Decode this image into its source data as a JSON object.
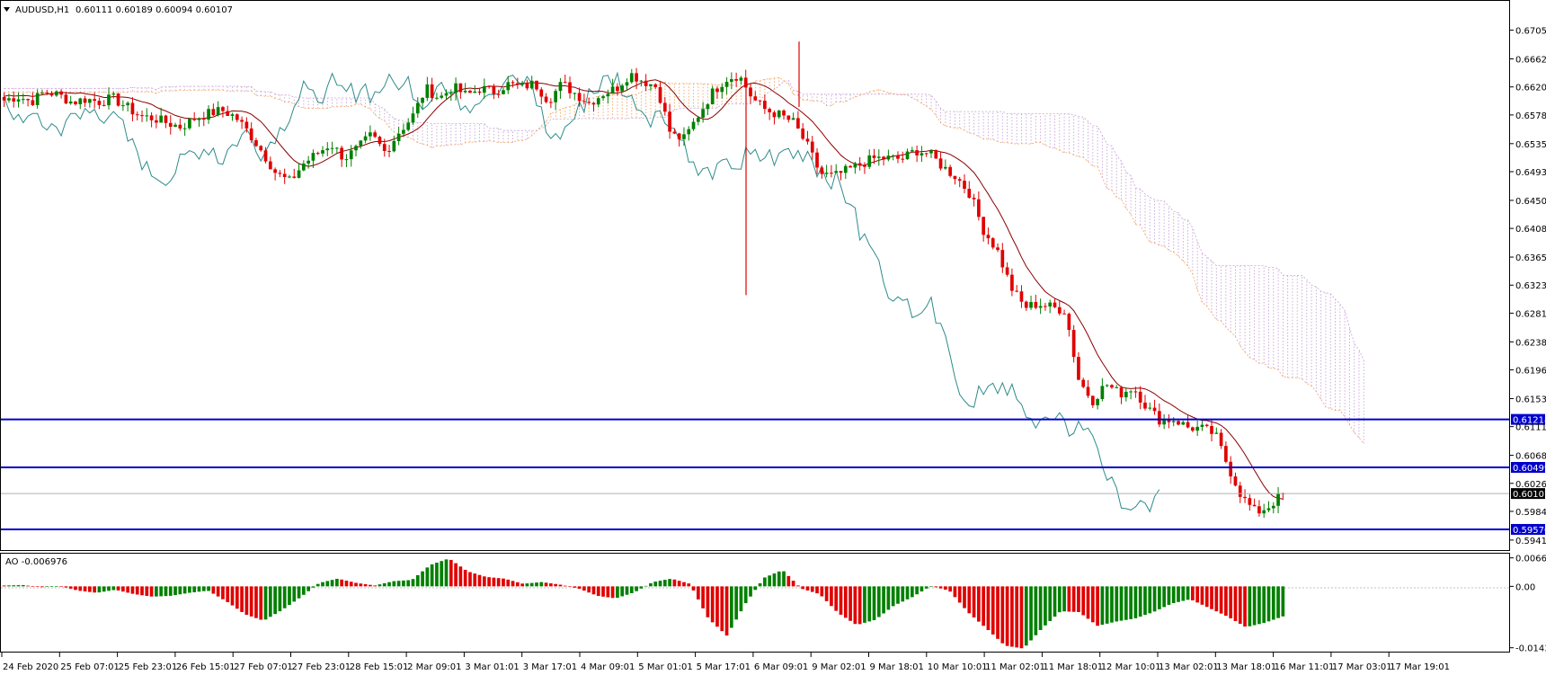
{
  "header": {
    "symbol": "AUDUSD,H1",
    "ohlc": "0.60111 0.60189 0.60094 0.60107",
    "menu_icon": "triangle-down-icon"
  },
  "indicator": {
    "label": "AO -0.006976"
  },
  "colors": {
    "bull": "#008000",
    "bear": "#e00000",
    "ma": "#8b0000",
    "chikou": "#2e8b8b",
    "kumo_orange": "#f4a460",
    "kumo_violet": "#c8a2d8",
    "hline": "#0000cc",
    "price_box": "#000000"
  },
  "chart_data": [
    {
      "type": "candlestick",
      "symbol": "AUDUSD",
      "timeframe": "H1",
      "ylim": [
        0.5926,
        0.6726
      ],
      "y_ticks": [
        "0.67050",
        "0.66620",
        "0.66200",
        "0.65780",
        "0.65350",
        "0.64930",
        "0.64500",
        "0.64080",
        "0.63650",
        "0.63230",
        "0.62810",
        "0.62380",
        "0.61960",
        "0.61530",
        "0.61110",
        "0.60680",
        "0.60260",
        "0.59840",
        "0.59410"
      ],
      "x_ticks": [
        "24 Feb 2020",
        "25 Feb 07:01",
        "25 Feb 23:01",
        "26 Feb 15:01",
        "27 Feb 07:01",
        "27 Feb 23:01",
        "28 Feb 15:01",
        "2 Mar 09:01",
        "3 Mar 01:01",
        "3 Mar 17:01",
        "4 Mar 09:01",
        "5 Mar 01:01",
        "5 Mar 17:01",
        "6 Mar 09:01",
        "9 Mar 02:01",
        "9 Mar 18:01",
        "10 Mar 10:01",
        "11 Mar 02:01",
        "11 Mar 18:01",
        "12 Mar 10:01",
        "13 Mar 02:01",
        "13 Mar 18:01",
        "16 Mar 11:01",
        "17 Mar 03:01",
        "17 Mar 19:01"
      ],
      "close_path": [
        0.66,
        0.6606,
        0.6598,
        0.6613,
        0.6608,
        0.6597,
        0.6602,
        0.6598,
        0.6603,
        0.659,
        0.6576,
        0.6573,
        0.6566,
        0.656,
        0.6573,
        0.658,
        0.6585,
        0.6575,
        0.6551,
        0.6522,
        0.649,
        0.6478,
        0.6505,
        0.652,
        0.6535,
        0.6513,
        0.6528,
        0.6548,
        0.6522,
        0.6552,
        0.6575,
        0.6618,
        0.6603,
        0.662,
        0.6607,
        0.6618,
        0.6613,
        0.6624,
        0.662,
        0.6625,
        0.66,
        0.6625,
        0.661,
        0.6596,
        0.661,
        0.6618,
        0.664,
        0.6629,
        0.662,
        0.6548,
        0.6542,
        0.6577,
        0.661,
        0.6632,
        0.6638,
        0.6603,
        0.6585,
        0.6578,
        0.6567,
        0.6533,
        0.649,
        0.6486,
        0.6495,
        0.6505,
        0.6513,
        0.6513,
        0.6512,
        0.6525,
        0.652,
        0.65,
        0.6485,
        0.646,
        0.6405,
        0.6375,
        0.632,
        0.629,
        0.6295,
        0.629,
        0.6285,
        0.618,
        0.615,
        0.6175,
        0.616,
        0.617,
        0.614,
        0.612,
        0.6122,
        0.611,
        0.6108,
        0.61,
        0.605,
        0.6005,
        0.5982,
        0.5992,
        0.6011
      ],
      "volatility_wicks": [
        {
          "x_tick": "9 Mar 02:01",
          "low": 0.6308,
          "high": 0.6625
        },
        {
          "x_tick": "9 Mar 18:01",
          "low": 0.659,
          "high": 0.6688
        }
      ],
      "horizontal_levels": [
        0.61218,
        0.60499,
        0.5957
      ],
      "level_labels": [
        "0.61218",
        "0.60499",
        "0.59570"
      ],
      "current_price": 0.60107,
      "current_price_label": "0.60107"
    },
    {
      "type": "bar",
      "name": "AO",
      "ylim": [
        -0.015,
        0.0072
      ],
      "y_ticks": [
        "0.006635",
        "0.00",
        "-0.014307"
      ],
      "shape_path": [
        0.0002,
        0.0003,
        -0.0002,
        0.0001,
        -0.001,
        -0.0015,
        -0.0008,
        -0.0018,
        -0.0024,
        -0.0022,
        -0.0015,
        -0.001,
        -0.0035,
        -0.0065,
        -0.008,
        -0.0055,
        -0.0025,
        0.0008,
        0.0018,
        0.0008,
        0.0002,
        0.0012,
        0.0015,
        0.005,
        0.0065,
        0.0035,
        0.0022,
        0.0018,
        0.0006,
        0.001,
        0.0004,
        -0.0005,
        -0.0022,
        -0.0028,
        -0.0014,
        0.001,
        0.0018,
        0.0006,
        -0.0075,
        -0.0115,
        -0.004,
        0.002,
        0.0038,
        -0.0005,
        -0.0018,
        -0.0062,
        -0.009,
        -0.0078,
        -0.0045,
        -0.0025,
        0.0001,
        -0.001,
        -0.006,
        -0.0098,
        -0.0138,
        -0.0145,
        -0.0098,
        -0.0058,
        -0.006,
        -0.0092,
        -0.0082,
        -0.0075,
        -0.006,
        -0.004,
        -0.003,
        -0.005,
        -0.007,
        -0.0095,
        -0.0085,
        -0.007
      ]
    }
  ]
}
